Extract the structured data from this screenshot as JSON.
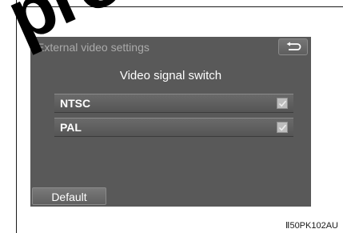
{
  "watermark": "pro",
  "screen": {
    "title": "External video settings",
    "back_icon": "return-arrow",
    "subtitle": "Video signal switch",
    "options": [
      {
        "label": "NTSC",
        "checked": true
      },
      {
        "label": "PAL",
        "checked": true
      }
    ],
    "default_label": "Default"
  },
  "figure_code": "Ⅱ50PK102AU"
}
